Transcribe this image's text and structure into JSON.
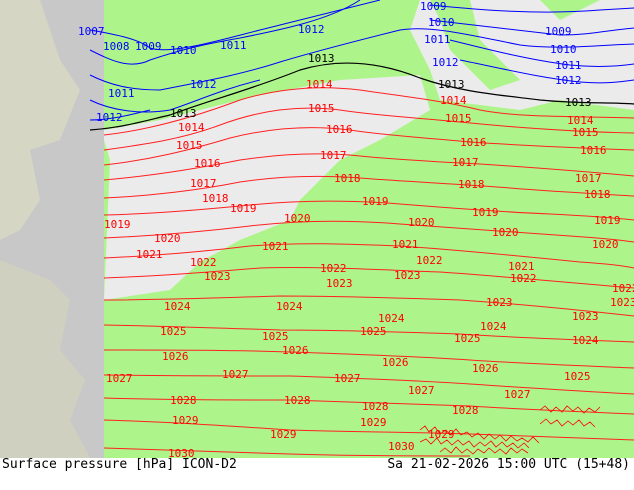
{
  "footer": {
    "title": "Surface pressure [hPa] ICON-D2",
    "datetime": "Sa 21-02-2026 15:00 UTC (15+48)"
  },
  "colors": {
    "model_domain": "#adf58a",
    "outside_domain": "#c8c8c8",
    "sea": "#e8e8e8",
    "isobar_low": "#0000ff",
    "isobar_ref": "#000000",
    "isobar_high": "#ff0000"
  },
  "isobar_labels": [
    {
      "text": "1007",
      "color": "blue"
    },
    {
      "text": "1008",
      "color": "blue"
    },
    {
      "text": "1009",
      "color": "blue"
    },
    {
      "text": "1010",
      "color": "blue"
    },
    {
      "text": "1011",
      "color": "blue"
    },
    {
      "text": "1012",
      "color": "blue"
    },
    {
      "text": "1013",
      "color": "black"
    },
    {
      "text": "1014",
      "color": "red"
    },
    {
      "text": "1015",
      "color": "red"
    },
    {
      "text": "1016",
      "color": "red"
    },
    {
      "text": "1017",
      "color": "red"
    },
    {
      "text": "1018",
      "color": "red"
    },
    {
      "text": "1019",
      "color": "red"
    },
    {
      "text": "1020",
      "color": "red"
    },
    {
      "text": "1021",
      "color": "red"
    },
    {
      "text": "1022",
      "color": "red"
    },
    {
      "text": "1023",
      "color": "red"
    },
    {
      "text": "1024",
      "color": "red"
    },
    {
      "text": "1025",
      "color": "red"
    },
    {
      "text": "1026",
      "color": "red"
    },
    {
      "text": "1027",
      "color": "red"
    },
    {
      "text": "1028",
      "color": "red"
    },
    {
      "text": "1029",
      "color": "red"
    },
    {
      "text": "1030",
      "color": "red"
    }
  ]
}
